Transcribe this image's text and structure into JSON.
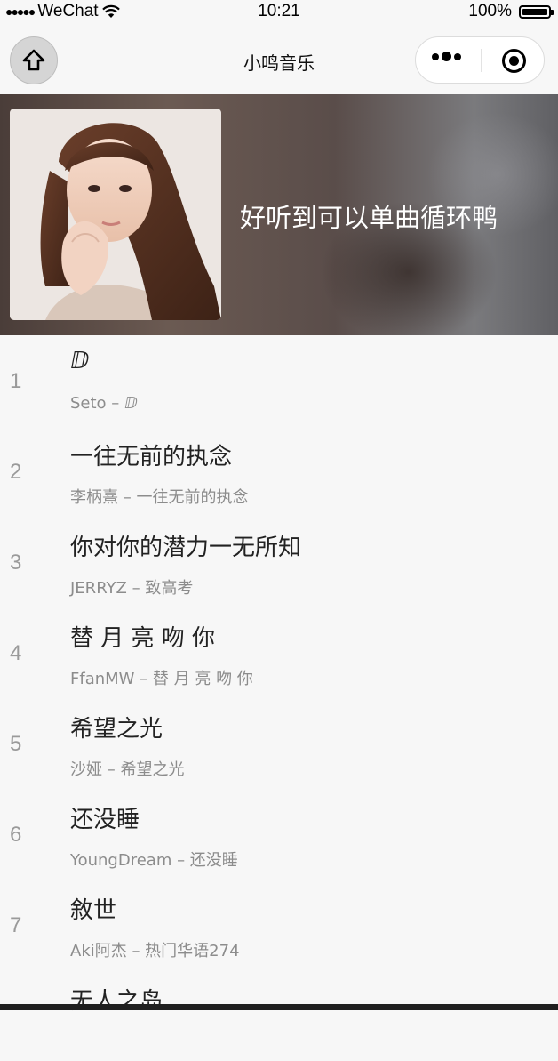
{
  "statusbar": {
    "signal_dots": "●●●●●",
    "carrier": "WeChat",
    "time": "10:21",
    "battery": "100%"
  },
  "navbar": {
    "title": "小鸣音乐",
    "home_icon": "home-icon",
    "more_icon": "more-dots-icon",
    "close_icon": "target-circle-icon"
  },
  "banner": {
    "title": "好听到可以单曲循环鸭"
  },
  "songs": [
    {
      "index": "1",
      "title": "ⅅ",
      "subtitle": "Seto – ⅅ"
    },
    {
      "index": "2",
      "title": "一往无前的执念",
      "subtitle": "李柄熹 – 一往无前的执念"
    },
    {
      "index": "3",
      "title": "你对你的潜力一无所知",
      "subtitle": "JERRYZ – 致高考"
    },
    {
      "index": "4",
      "title": "替 月 亮 吻 你",
      "subtitle": "FfanMW – 替 月 亮 吻 你"
    },
    {
      "index": "5",
      "title": "希望之光",
      "subtitle": "沙娅 – 希望之光"
    },
    {
      "index": "6",
      "title": "还没睡",
      "subtitle": "YoungDream – 还没睡"
    },
    {
      "index": "7",
      "title": "敘世",
      "subtitle": "Aki阿杰 – 热门华语274"
    },
    {
      "index": "",
      "title": "无人之岛",
      "subtitle": ""
    }
  ]
}
